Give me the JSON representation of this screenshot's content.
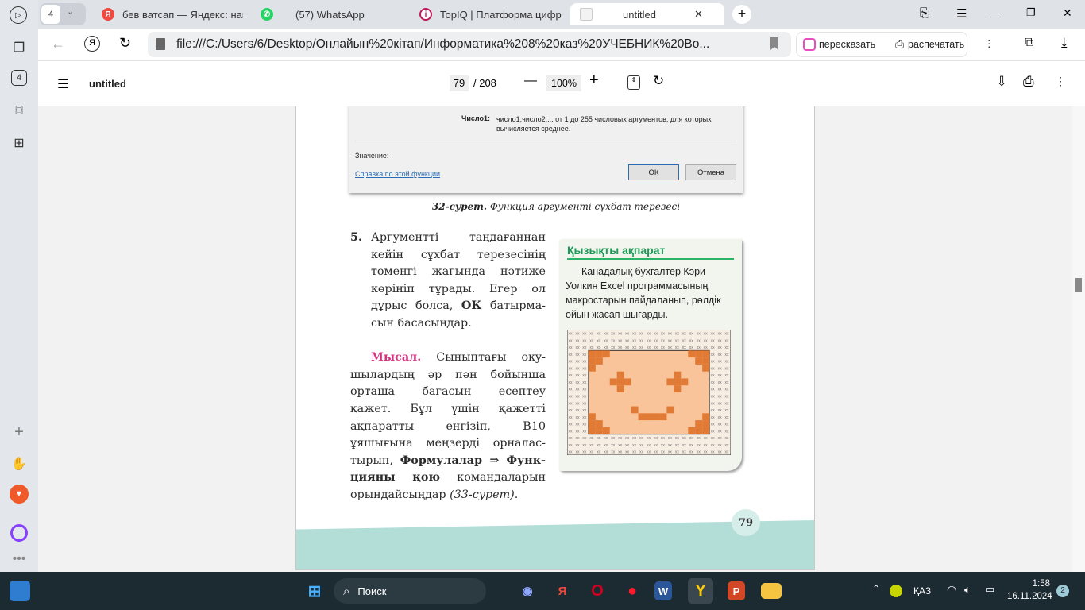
{
  "browser": {
    "tab_count": "4",
    "tabs": [
      {
        "title": "бев ватсап — Яндекс: наш",
        "icon": "yandex-icon",
        "color": "#f0483e"
      },
      {
        "title": "(57) WhatsApp",
        "icon": "whatsapp-icon",
        "color": "#25d366"
      },
      {
        "title": "TopIQ | Платформа цифро",
        "icon": "topiq-icon",
        "color": "#c2185b"
      },
      {
        "title": "untitled",
        "icon": "pdf-file-icon",
        "active": true
      }
    ],
    "url": "file:///C:/Users/6/Desktop/Онлайын%20кітап/Информатика%208%20каз%20УЧЕБНИК%20Во...",
    "retell_label": "пересказать",
    "print_label": "распечатать",
    "sidebar_badge": "4"
  },
  "pdf": {
    "title": "untitled",
    "page": "79",
    "total": "/ 208",
    "zoom": "100%"
  },
  "dialog": {
    "arg_label": "Число1:",
    "arg_desc": "число1;число2;... от 1 до 255 числовых аргументов, для которых вычисляется среднее.",
    "value_label": "Значение:",
    "help_link": "Справка по этой функции",
    "ok": "ОК",
    "cancel": "Отмена"
  },
  "caption": {
    "num": "32-сурет.",
    "text": " Функция аргументі сұхбат терезесі"
  },
  "body": {
    "item_number": "5.",
    "para1": [
      [
        {
          "t": "Аргументті таңдағаннан"
        }
      ],
      [
        {
          "t": "кейін сұхбат терезесінің"
        }
      ],
      [
        {
          "t": "төменгі жағында нәтиже"
        }
      ],
      [
        {
          "t": "көрініп тұрады. Егер ол"
        }
      ],
      [
        {
          "t": "дұрыс болса, "
        },
        {
          "t": "ОК",
          "s": "b"
        },
        {
          "t": " батырма-"
        }
      ],
      [
        {
          "t": "сын басасыңдар."
        }
      ]
    ],
    "para2": [
      [
        {
          "t": "Мысал.",
          "s": "pink"
        },
        {
          "t": " Сыныптағы оқу-"
        }
      ],
      [
        {
          "t": "шылардың әр пән бойынша"
        }
      ],
      [
        {
          "t": "орташа бағасын есептеу"
        }
      ],
      [
        {
          "t": "қажет. Бұл үшін қажетті"
        }
      ],
      [
        {
          "t": "ақпаратты енгізіп, В10"
        }
      ],
      [
        {
          "t": "ұяшығына меңзерді орналас-"
        }
      ],
      [
        {
          "t": "тырып, "
        },
        {
          "t": "Формулалар ⇒ Функ-",
          "s": "b"
        }
      ],
      [
        {
          "t": "цияны қою",
          "s": "b"
        },
        {
          "t": " командаларын"
        }
      ],
      [
        {
          "t": "орындайсыңдар "
        },
        {
          "t": "(33-сурет)",
          "s": "it"
        },
        {
          "t": "."
        }
      ]
    ]
  },
  "info": {
    "title": "Қызықты ақпарат",
    "text": "Канадалық бухгалтер Кэри Уолкин Excel программасының макростарын пайдаланып, рөлдік ойын жасап шығарды."
  },
  "page_number": "79",
  "taskbar": {
    "search": "Поиск",
    "lang": "ҚАЗ",
    "time": "1:58",
    "date": "16.11.2024",
    "notifications": "2"
  }
}
